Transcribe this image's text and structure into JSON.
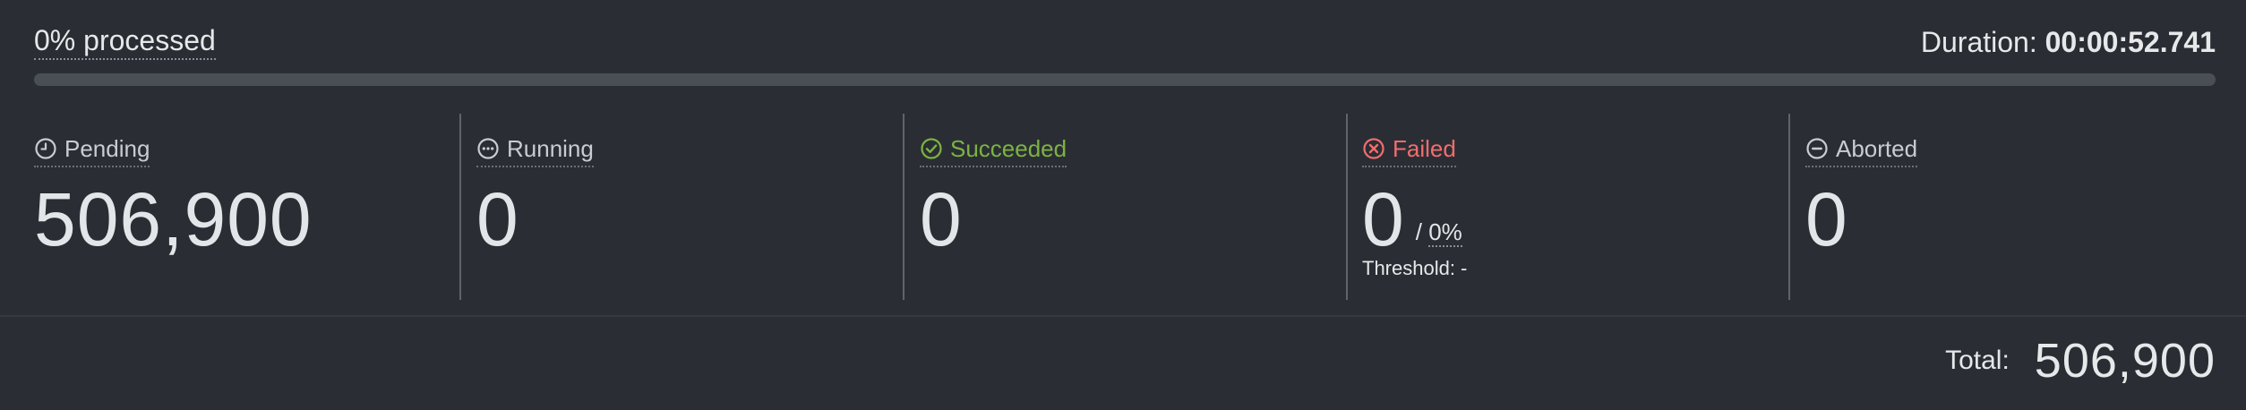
{
  "progress": {
    "processed_label": "0% processed",
    "percent": 0,
    "duration_label": "Duration:",
    "duration_value": "00:00:52.741",
    "fill_color": "#0a84ff"
  },
  "stats": [
    {
      "key": "pending",
      "label": "Pending",
      "value": "506,900",
      "icon": "clock-icon",
      "color": "#c9ccd0"
    },
    {
      "key": "running",
      "label": "Running",
      "value": "0",
      "icon": "ellipsis-circle-icon",
      "color": "#c9ccd0"
    },
    {
      "key": "succeeded",
      "label": "Succeeded",
      "value": "0",
      "icon": "check-circle-icon",
      "color": "#7cb342"
    },
    {
      "key": "failed",
      "label": "Failed",
      "value": "0",
      "icon": "x-circle-icon",
      "color": "#f26d6d",
      "ratio_sep": "/",
      "ratio": "0%",
      "threshold": "Threshold: -"
    },
    {
      "key": "aborted",
      "label": "Aborted",
      "value": "0",
      "icon": "minus-circle-icon",
      "color": "#c9ccd0"
    }
  ],
  "total": {
    "label": "Total:",
    "value": "506,900"
  }
}
